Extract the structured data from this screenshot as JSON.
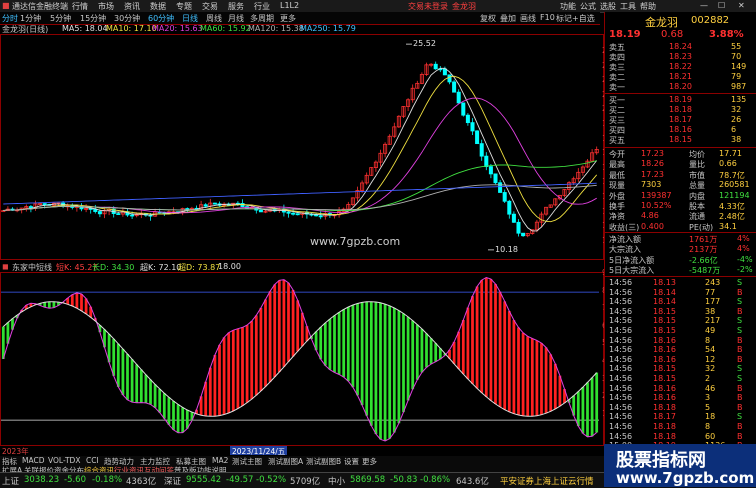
{
  "app": {
    "title": "通达信金融终端",
    "menu": [
      "行情",
      "市场",
      "资讯",
      "数据",
      "专题",
      "交易",
      "服务",
      "行业",
      "L1L2"
    ],
    "notice": "交易未登录",
    "stock_link": "金龙羽",
    "window_buttons": [
      "功能",
      "公式",
      "选股",
      "工具",
      "帮助"
    ]
  },
  "toolbar": {
    "items": [
      "分时",
      "1分钟",
      "5分钟",
      "15分钟",
      "30分钟",
      "60分钟",
      "日线",
      "周线",
      "月线",
      "多周期",
      "更多"
    ],
    "active": "日线",
    "right_items": [
      "复权",
      "叠加",
      "画线",
      "F10",
      "标记",
      "+自选",
      "返回"
    ]
  },
  "main_chart": {
    "legend": [
      {
        "label": "金龙羽(日线)",
        "color": "#d0d0d0"
      },
      {
        "label": "MA5: 18.04",
        "color": "#e0e0e0"
      },
      {
        "label": "MA10: 17.10",
        "color": "#f0e040"
      },
      {
        "label": "MA20: 15.63",
        "color": "#e040e0"
      },
      {
        "label": "MA60: 15.92",
        "color": "#40e040"
      },
      {
        "label": "MA120: 15.38",
        "color": "#b0b0b0"
      },
      {
        "label": "MA250: 15.79",
        "color": "#40c0ff"
      }
    ],
    "y_ticks": [
      "24.00",
      "23.00",
      "22.00",
      "21.00",
      "20.00",
      "19.00",
      "18.00",
      "17.00",
      "16.00",
      "15.00",
      "14.00",
      "13.00",
      "12.00",
      "11.00"
    ],
    "high_label": "25.52",
    "low_label": "10.18",
    "colors": {
      "up": "#ff3030",
      "down": "#00ffff",
      "ma5": "#e0e0e0",
      "ma10": "#f0e040",
      "ma20": "#e040e0",
      "ma60": "#40e040",
      "ma120": "#b0b0b0",
      "ma250": "#4060ff"
    }
  },
  "indicator": {
    "legend": [
      {
        "label": "东家中短线",
        "color": "#d0d0d0"
      },
      {
        "label": "短K: 45.27",
        "color": "#ff4040"
      },
      {
        "label": "长D: 34.30",
        "color": "#40e040"
      },
      {
        "label": "超K: 72.10",
        "color": "#e0e0e0"
      },
      {
        "label": "超D: 73.87",
        "color": "#f0e040"
      },
      {
        "label": "18.00",
        "color": "#e0e0e0"
      }
    ],
    "y_ticks": [
      "90.00",
      "80.00",
      "70.00",
      "60.00",
      "50.00",
      "40.00",
      "30.00",
      "20.00",
      "10.00"
    ],
    "period_marks": [
      "2023年",
      "2023/11/24/五"
    ]
  },
  "tabs": [
    "指标",
    "MACD",
    "VOL-TDX",
    "CCI",
    "趋势动力",
    "主力监控",
    "私募主图",
    "MA2",
    "测试主图",
    "测试副图A",
    "测试副图B",
    "设置",
    "更多"
  ],
  "subtabs": [
    "扩展A",
    "关联报价",
    "资金分布",
    "综合资讯",
    "行业资讯",
    "互动问答",
    "普及版功能说明"
  ],
  "subtab_active": "综合资讯",
  "watermark": "www.7gpzb.com",
  "quote": {
    "name": "金龙羽",
    "code": "002882",
    "price": "18.19",
    "change": "0.68",
    "pct": "3.88%",
    "asks": [
      {
        "label": "卖五",
        "price": "18.24",
        "vol": "55"
      },
      {
        "label": "卖四",
        "price": "18.23",
        "vol": "70"
      },
      {
        "label": "卖三",
        "price": "18.22",
        "vol": "149"
      },
      {
        "label": "卖二",
        "price": "18.21",
        "vol": "79"
      },
      {
        "label": "卖一",
        "price": "18.20",
        "vol": "987"
      }
    ],
    "bids": [
      {
        "label": "买一",
        "price": "18.19",
        "vol": "135"
      },
      {
        "label": "买二",
        "price": "18.18",
        "vol": "32"
      },
      {
        "label": "买三",
        "price": "18.17",
        "vol": "26"
      },
      {
        "label": "买四",
        "price": "18.16",
        "vol": "6"
      },
      {
        "label": "买五",
        "price": "18.15",
        "vol": "38"
      }
    ],
    "stats": [
      {
        "k1": "今开",
        "v1": "17.23",
        "k2": "均价",
        "v2": "17.71"
      },
      {
        "k1": "最高",
        "v1": "18.26",
        "k2": "量比",
        "v2": "0.66"
      },
      {
        "k1": "最低",
        "v1": "17.23",
        "k2": "市值",
        "v2": "78.7亿"
      },
      {
        "k1": "现量",
        "v1": "7303",
        "k2": "总量",
        "v2": "260581"
      },
      {
        "k1": "外盘",
        "v1": "139387",
        "k2": "内盘",
        "v2": "121194"
      },
      {
        "k1": "换手",
        "v1": "10.52%",
        "k2": "股本",
        "v2": "4.33亿"
      },
      {
        "k1": "净资",
        "v1": "4.86",
        "k2": "流通",
        "v2": "2.48亿"
      },
      {
        "k1": "收益(三)",
        "v1": "0.400",
        "k2": "PE(动)",
        "v2": "34.1"
      }
    ],
    "flows": [
      {
        "label": "净流入额",
        "value": "1761万",
        "pct": "4%"
      },
      {
        "label": "大宗流入",
        "value": "2137万",
        "pct": "4%"
      },
      {
        "label": "5日净流入额",
        "value": "-2.66亿",
        "pct": "-4%"
      },
      {
        "label": "5日大宗流入",
        "value": "-5487万",
        "pct": "-2%"
      }
    ],
    "ticks": [
      {
        "t": "14:56",
        "p": "18.13",
        "v": "243",
        "s": "S"
      },
      {
        "t": "14:56",
        "p": "18.14",
        "v": "77",
        "s": "B"
      },
      {
        "t": "14:56",
        "p": "18.14",
        "v": "177",
        "s": "S"
      },
      {
        "t": "14:56",
        "p": "18.15",
        "v": "38",
        "s": "B"
      },
      {
        "t": "14:56",
        "p": "18.15",
        "v": "217",
        "s": "S"
      },
      {
        "t": "14:56",
        "p": "18.15",
        "v": "49",
        "s": "S"
      },
      {
        "t": "14:56",
        "p": "18.16",
        "v": "8",
        "s": "B"
      },
      {
        "t": "14:56",
        "p": "18.16",
        "v": "54",
        "s": "B"
      },
      {
        "t": "14:56",
        "p": "18.16",
        "v": "12",
        "s": "B"
      },
      {
        "t": "14:56",
        "p": "18.15",
        "v": "32",
        "s": "S"
      },
      {
        "t": "14:56",
        "p": "18.15",
        "v": "2",
        "s": "S"
      },
      {
        "t": "14:56",
        "p": "18.16",
        "v": "46",
        "s": "B"
      },
      {
        "t": "14:56",
        "p": "18.16",
        "v": "3",
        "s": "B"
      },
      {
        "t": "14:56",
        "p": "18.18",
        "v": "5",
        "s": "B"
      },
      {
        "t": "14:56",
        "p": "18.17",
        "v": "18",
        "s": "S"
      },
      {
        "t": "14:56",
        "p": "18.18",
        "v": "8",
        "s": "B"
      },
      {
        "t": "14:56",
        "p": "18.18",
        "v": "60",
        "s": "B"
      },
      {
        "t": "15:00",
        "p": "18.19",
        "v": "1136",
        "s": "B"
      }
    ],
    "time": "19:23:43"
  },
  "status": {
    "items": [
      {
        "label": "上证",
        "val": "3038.23",
        "chg": "-5.60",
        "pct": "-0.18%",
        "amt": "4363亿",
        "up": false
      },
      {
        "label": "深证",
        "val": "9555.42",
        "chg": "-49.57",
        "pct": "-0.52%",
        "amt": "5709亿",
        "up": false
      },
      {
        "label": "中小",
        "val": "5869.58",
        "chg": "-50.83",
        "pct": "-0.86%",
        "amt": "643.6亿",
        "up": false
      }
    ],
    "broker": "平安证券上海上证云行情",
    "badge_title": "股票指标网",
    "badge_url": "www.7gpzb.com"
  }
}
